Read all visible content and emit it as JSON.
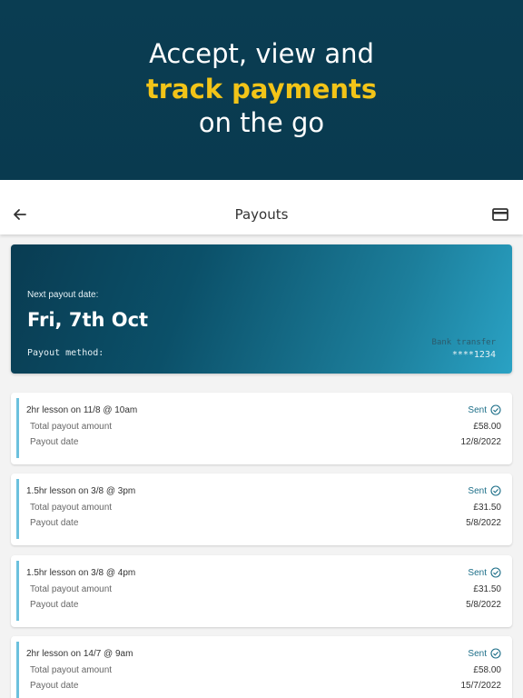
{
  "hero": {
    "line1": "Accept, view and",
    "line2": "track payments",
    "line3": "on the go",
    "highlight_color": "#f2c418",
    "background_color": "#0a3d52"
  },
  "appbar": {
    "title": "Payouts",
    "back_icon": "arrow-left-icon",
    "card_icon": "credit-card-icon"
  },
  "next_payout": {
    "label": "Next payout date:",
    "date": "Fri, 7th Oct",
    "method_label": "Payout method:",
    "method_type": "Bank transfer",
    "method_account": "****1234"
  },
  "payouts": [
    {
      "lesson": "2hr lesson on 11/8 @ 10am",
      "status": "Sent",
      "amount_label": "Total payout amount",
      "amount": "£58.00",
      "date_label": "Payout date",
      "date": "12/8/2022"
    },
    {
      "lesson": "1.5hr lesson on 3/8 @ 3pm",
      "status": "Sent",
      "amount_label": "Total payout amount",
      "amount": "£31.50",
      "date_label": "Payout date",
      "date": "5/8/2022"
    },
    {
      "lesson": "1.5hr lesson on 3/8 @ 4pm",
      "status": "Sent",
      "amount_label": "Total payout amount",
      "amount": "£31.50",
      "date_label": "Payout date",
      "date": "5/8/2022"
    },
    {
      "lesson": "2hr lesson on 14/7 @ 9am",
      "status": "Sent",
      "amount_label": "Total payout amount",
      "amount": "£58.00",
      "date_label": "Payout date",
      "date": "15/7/2022"
    }
  ],
  "colors": {
    "accent": "#1c6e88",
    "item_bar": "#6cc1dd"
  }
}
